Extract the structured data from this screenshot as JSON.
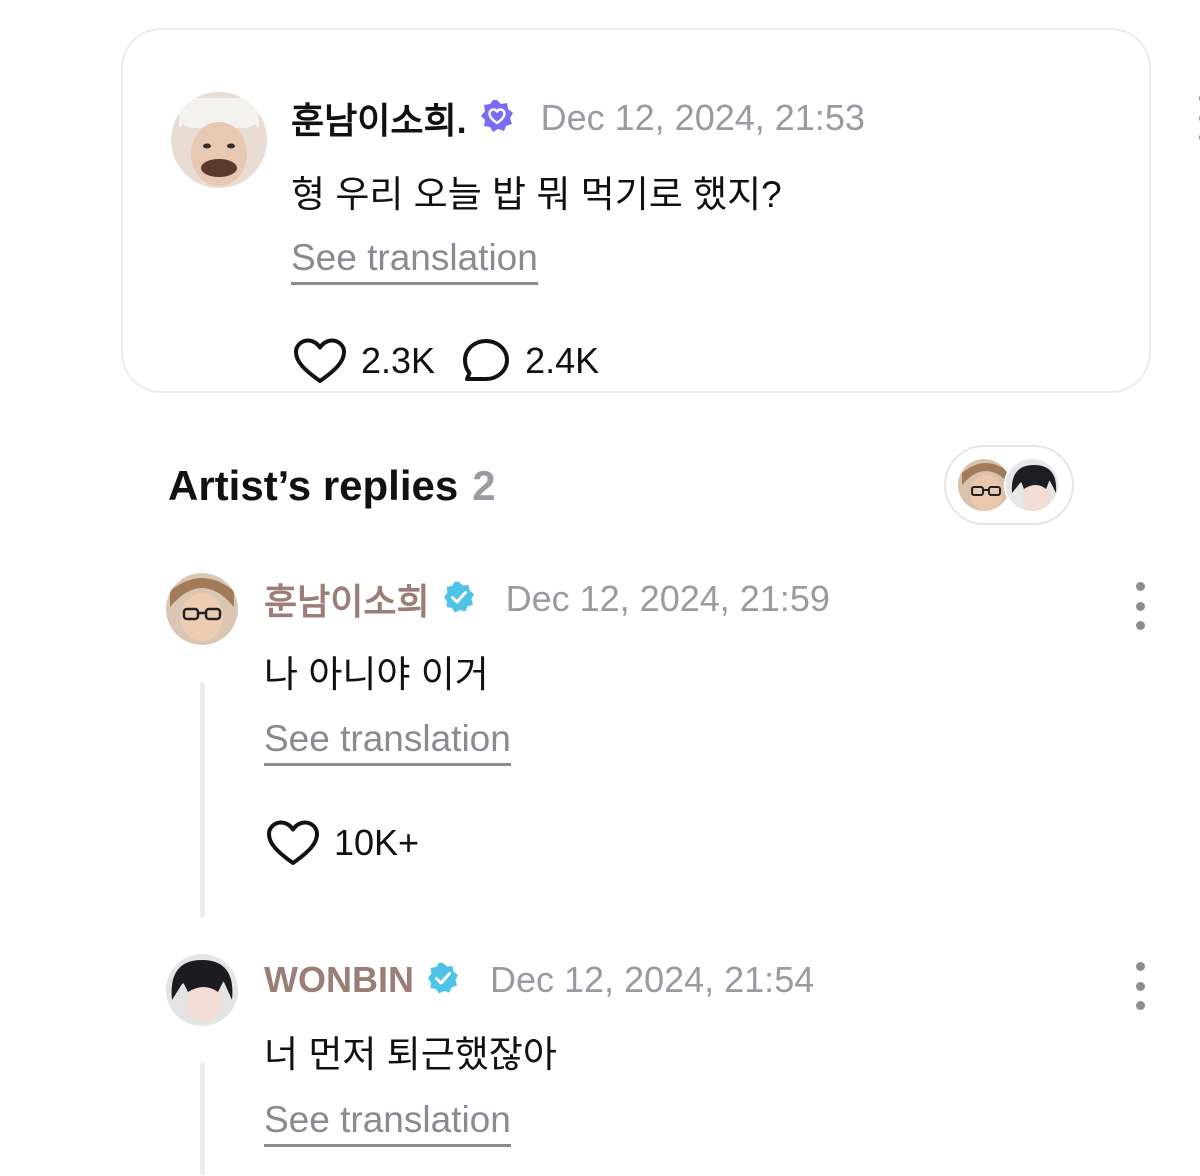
{
  "post": {
    "author": "훈남이소희.",
    "timestamp": "Dec 12, 2024, 21:53",
    "text": "형 우리 오늘 밥 뭐 먹기로 했지?",
    "translate_label": "See translation",
    "likes": "2.3K",
    "comments": "2.4K",
    "avatar_icon": "user-avatar-masked",
    "badge_icon": "fan-verified-heart-badge",
    "badge_color": "#7b6cf6"
  },
  "replies_header": {
    "label": "Artist’s replies",
    "count": "2"
  },
  "replies": [
    {
      "author": "훈남이소희",
      "timestamp": "Dec 12, 2024, 21:59",
      "text": "나 아니야 이거",
      "translate_label": "See translation",
      "likes": "10K+",
      "avatar_icon": "artist-avatar-glasses",
      "badge_icon": "artist-verified-badge",
      "badge_color": "#4fc3e6"
    },
    {
      "author": "WONBIN",
      "timestamp": "Dec 12, 2024, 21:54",
      "text": "너 먼저 퇴근했잖아",
      "translate_label": "See translation",
      "avatar_icon": "artist-avatar-dark-hair",
      "badge_icon": "artist-verified-badge",
      "badge_color": "#4fc3e6"
    }
  ],
  "colors": {
    "artist_name": "#9b7e78",
    "muted_text": "#9a9aa2",
    "card_border": "#ececf0"
  }
}
